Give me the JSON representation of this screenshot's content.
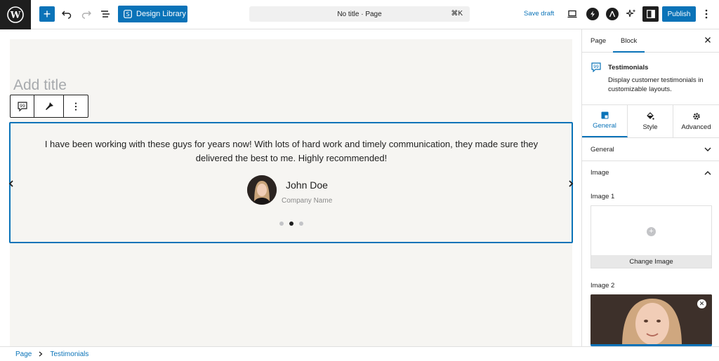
{
  "topbar": {
    "design_library_label": "Design Library",
    "doc_title": "No title · Page",
    "shortcut": "⌘K",
    "save_draft": "Save draft",
    "publish": "Publish"
  },
  "editor": {
    "title_placeholder": "Add title"
  },
  "testimonial": {
    "quote": "I have been working with these guys for years now! With lots of hard work and timely communication, they made sure they delivered the best to me. Highly recommended!",
    "author_name": "John Doe",
    "author_company": "Company Name",
    "slide_count": 3,
    "active_slide": 2
  },
  "sidebar": {
    "tabs": [
      {
        "label": "Page"
      },
      {
        "label": "Block"
      }
    ],
    "active_tab": "Block",
    "block_title": "Testimonials",
    "block_description": "Display customer testimonials in customizable layouts.",
    "sub_tabs": [
      {
        "label": "General"
      },
      {
        "label": "Style"
      },
      {
        "label": "Advanced"
      }
    ],
    "panels": [
      {
        "label": "General",
        "state": "collapsed"
      },
      {
        "label": "Image",
        "state": "expanded"
      }
    ],
    "image1_label": "Image 1",
    "change_image": "Change Image",
    "image2_label": "Image 2"
  },
  "footer": {
    "crumbs": [
      {
        "label": "Page"
      },
      {
        "label": "Testimonials"
      }
    ]
  },
  "colors": {
    "accent": "#0a73b8",
    "dark": "#1e1e1e",
    "canvas": "#f6f5f2"
  }
}
